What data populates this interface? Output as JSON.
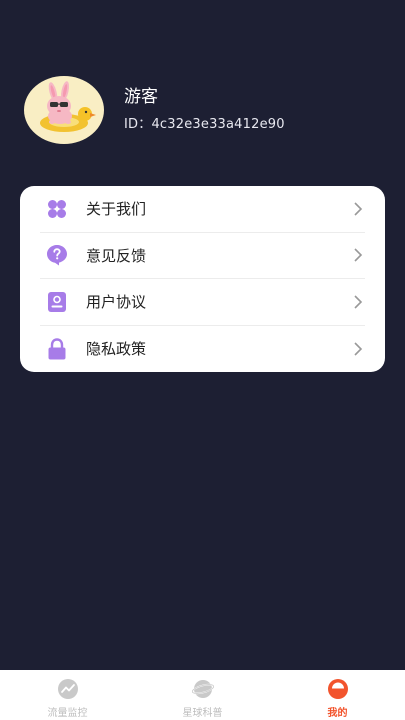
{
  "profile": {
    "name": "游客",
    "id_text": "ID：4c32e3e33a412e90"
  },
  "menu": {
    "items": [
      {
        "label": "关于我们",
        "icon": "grid-icon"
      },
      {
        "label": "意见反馈",
        "icon": "question-bubble-icon"
      },
      {
        "label": "用户协议",
        "icon": "document-user-icon"
      },
      {
        "label": "隐私政策",
        "icon": "lock-icon"
      }
    ]
  },
  "tabbar": {
    "tabs": [
      {
        "label": "流量监控",
        "icon": "traffic-monitor-icon",
        "active": false
      },
      {
        "label": "星球科普",
        "icon": "planet-icon",
        "active": false
      },
      {
        "label": "我的",
        "icon": "user-icon",
        "active": true
      }
    ]
  },
  "colors": {
    "background": "#1d1f33",
    "accent_purple": "#a77ce8",
    "active_tab": "#f2542d",
    "inactive_tab": "#bdbdbd"
  }
}
